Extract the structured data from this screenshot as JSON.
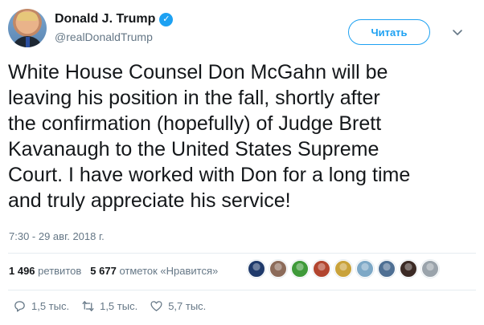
{
  "author": {
    "name": "Donald J. Trump",
    "handle": "@realDonaldTrump",
    "verified_glyph": "✓"
  },
  "follow_button": "Читать",
  "tweet": {
    "lines": [
      "White House Counsel Don McGahn will be",
      "leaving his position in the fall, shortly after",
      "the confirmation (hopefully) of Judge Brett",
      "Kavanaugh to the United States Supreme",
      "Court. I have worked with Don for a long time",
      "and truly appreciate his service!"
    ],
    "timestamp": "7:30 - 29 авг. 2018 г."
  },
  "stats": {
    "retweets_count": "1 496",
    "retweets_label": "ретвитов",
    "likes_count": "5 677",
    "likes_label": "отметок «Нравится»"
  },
  "likers": [
    {
      "color": "#1f3a6b"
    },
    {
      "color": "#8c6b5a"
    },
    {
      "color": "#3f9a3a"
    },
    {
      "color": "#b2452f"
    },
    {
      "color": "#c9a23a"
    },
    {
      "color": "#7da8c6"
    },
    {
      "color": "#4e6f93"
    },
    {
      "color": "#3b2a25"
    },
    {
      "color": "#9aa3ab"
    }
  ],
  "actions": {
    "reply_count": "1,5 тыс.",
    "retweet_count": "1,5 тыс.",
    "like_count": "5,7 тыс."
  },
  "icons": {
    "verified": "verified-icon",
    "caret": "chevron-down-icon",
    "reply": "reply-icon",
    "retweet": "retweet-icon",
    "like": "heart-icon"
  },
  "colors": {
    "accent": "#1da1f2",
    "muted": "#657786",
    "text": "#14171a"
  }
}
